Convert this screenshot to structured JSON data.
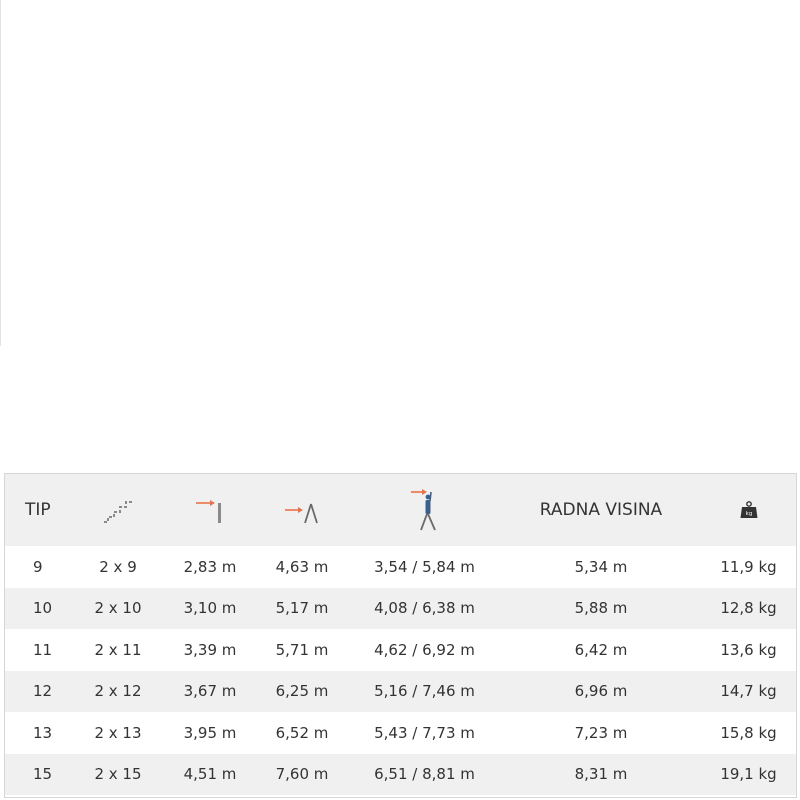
{
  "table": {
    "headers": {
      "tip": "TIP",
      "steps": "stairs-icon",
      "ladder_height": "ladder-length-icon",
      "a_frame_height": "a-frame-height-icon",
      "reach_height": "person-reach-icon",
      "work_height": "RADNA VISINA",
      "weight": "kg",
      "weight_icon": "weight-icon"
    },
    "accent_color": "#e8734a",
    "rows": [
      {
        "tip": "9",
        "steps": "2 x 9",
        "ladder_height": "2,83 m",
        "a_frame_height": "4,63 m",
        "reach_height": "3,54 / 5,84 m",
        "work_height": "5,34 m",
        "weight": "11,9 kg"
      },
      {
        "tip": "10",
        "steps": "2 x 10",
        "ladder_height": "3,10 m",
        "a_frame_height": "5,17 m",
        "reach_height": "4,08 / 6,38 m",
        "work_height": "5,88 m",
        "weight": "12,8 kg"
      },
      {
        "tip": "11",
        "steps": "2 x 11",
        "ladder_height": "3,39 m",
        "a_frame_height": "5,71 m",
        "reach_height": "4,62 / 6,92 m",
        "work_height": "6,42 m",
        "weight": "13,6 kg"
      },
      {
        "tip": "12",
        "steps": "2 x 12",
        "ladder_height": "3,67 m",
        "a_frame_height": "6,25 m",
        "reach_height": "5,16 / 7,46 m",
        "work_height": "6,96 m",
        "weight": "14,7 kg"
      },
      {
        "tip": "13",
        "steps": "2 x 13",
        "ladder_height": "3,95 m",
        "a_frame_height": "6,52 m",
        "reach_height": "5,43 / 7,73 m",
        "work_height": "7,23 m",
        "weight": "15,8 kg"
      },
      {
        "tip": "15",
        "steps": "2 x 15",
        "ladder_height": "4,51 m",
        "a_frame_height": "7,60 m",
        "reach_height": "6,51 / 8,81 m",
        "work_height": "8,31 m",
        "weight": "19,1 kg"
      }
    ]
  }
}
